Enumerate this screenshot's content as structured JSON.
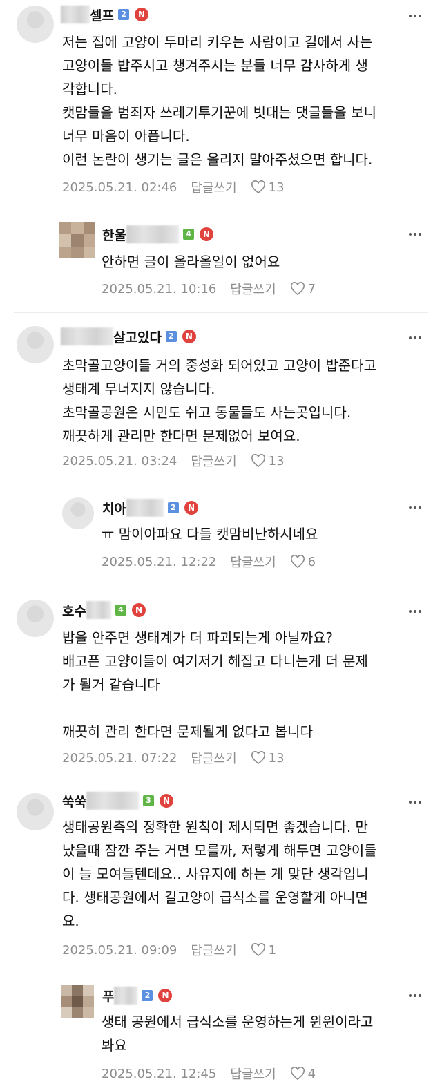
{
  "colors": {
    "level_blue": "#5b8fe0",
    "level_green": "#5fb546",
    "n_badge": "#e0423d",
    "meta_gray": "#8e8e8e"
  },
  "reply_label": "답글쓰기",
  "comments": [
    {
      "nick": "셀프",
      "level": "2",
      "badge": "N",
      "text": "저는 집에 고양이 두마리 키우는 사람이고 길에서 사는\n고양이들 밥주시고 챙겨주시는 분들 너무 감사하게 생\n각합니다.\n캣맘들을 범죄자 쓰레기투기꾼에 빗대는 댓글들을 보니\n너무 마음이 아픕니다.\n이런 논란이 생기는 글은 올리지 말아주셨으면 합니다.",
      "date": "2025.05.21. 02:46",
      "likes": "13"
    },
    {
      "nick": "한울",
      "level": "4",
      "badge": "N",
      "text": "안하면 글이 올라올일이 없어요",
      "date": "2025.05.21. 10:16",
      "likes": "7"
    },
    {
      "nick": "살고있다",
      "level": "2",
      "badge": "N",
      "text": "초막골고양이들 거의 중성화 되어있고 고양이 밥준다고\n생태계 무너지지 않습니다.\n초막골공원은 시민도 쉬고 동물들도 사는곳입니다.\n깨끗하게 관리만 한다면 문제없어 보여요.",
      "date": "2025.05.21. 03:24",
      "likes": "13"
    },
    {
      "nick": "치아",
      "level": "2",
      "badge": "N",
      "text": "ㅠ 맘이아파요 다들 캣맘비난하시네요",
      "date": "2025.05.21. 12:22",
      "likes": "6"
    },
    {
      "nick": "호수",
      "level": "4",
      "badge": "N",
      "text": "밥을 안주면 생태계가 더 파괴되는게 아닐까요?\n배고픈 고양이들이 여기저기 헤집고 다니는게 더 문제\n가 될거 같습니다\n\n깨끗히 관리 한다면 문제될게 없다고 봅니다",
      "date": "2025.05.21. 07:22",
      "likes": "13"
    },
    {
      "nick": "쑥쑥",
      "level": "3",
      "badge": "N",
      "text": "생태공원측의 정확한 원칙이 제시되면 좋겠습니다. 만\n났을때 잠깐 주는 거면 모를까, 저렇게 해두면 고양이들\n이 늘 모여들텐데요.. 사유지에 하는 게 맞단 생각입니\n다. 생태공원에서 길고양이 급식소를 운영할게 아니면\n요.",
      "date": "2025.05.21. 09:09",
      "likes": "1"
    },
    {
      "nick": "푸",
      "level": "2",
      "badge": "N",
      "text": "생태 공원에서 급식소를 운영하는게 윈윈이라고\n봐요",
      "date": "2025.05.21. 12:45",
      "likes": "4"
    }
  ]
}
